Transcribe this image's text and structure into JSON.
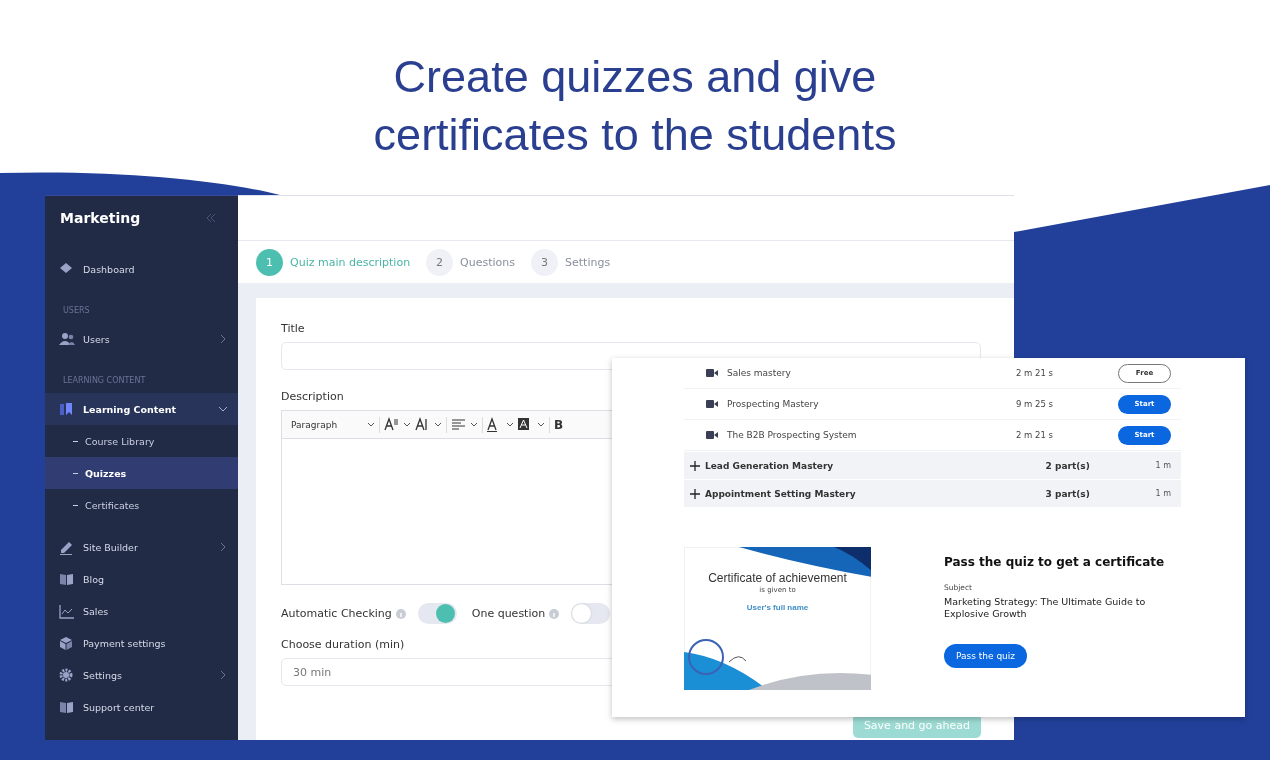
{
  "heading": "Create quizzes and give\ncertificates to the students",
  "sidebar": {
    "title": "Marketing",
    "items": [
      {
        "kind": "item",
        "label": "Dashboard",
        "selected": false
      },
      {
        "kind": "section",
        "label": "USERS"
      },
      {
        "kind": "item",
        "label": "Users",
        "selected": false,
        "expanded": false
      },
      {
        "kind": "section",
        "label": "LEARNING CONTENT"
      },
      {
        "kind": "item",
        "label": "Learning Content",
        "selected": true,
        "expanded": true
      },
      {
        "kind": "subitem",
        "label": "Course Library",
        "selected": false
      },
      {
        "kind": "subitem",
        "label": "Quizzes",
        "selected": true
      },
      {
        "kind": "subitem",
        "label": "Certificates",
        "selected": false
      },
      {
        "kind": "item",
        "label": "Site Builder",
        "selected": false,
        "expanded": false
      },
      {
        "kind": "item",
        "label": "Blog",
        "selected": false
      },
      {
        "kind": "item",
        "label": "Sales",
        "selected": false
      },
      {
        "kind": "item",
        "label": "Payment settings",
        "selected": false
      },
      {
        "kind": "item",
        "label": "Settings",
        "selected": false,
        "expanded": false
      },
      {
        "kind": "item",
        "label": "Support center",
        "selected": false
      }
    ]
  },
  "steps": [
    {
      "number": "1",
      "label": "Quiz main description",
      "selected": true
    },
    {
      "number": "2",
      "label": "Questions",
      "selected": false
    },
    {
      "number": "3",
      "label": "Settings",
      "selected": false
    }
  ],
  "form": {
    "title_label": "Title",
    "description_label": "Description",
    "block_format": "Paragraph",
    "bold": "B",
    "toggles": [
      {
        "label": "Automatic Checking",
        "on": true
      },
      {
        "label": "One question",
        "on": false
      }
    ],
    "duration_label": "Choose duration (min)",
    "duration": "30 min",
    "save_button": {
      "label": "Save and go ahead",
      "disabled": true
    }
  },
  "preview": {
    "lessons": [
      {
        "title": "Sales mastery",
        "duration": "2 m 21 s",
        "action": {
          "label": "Free",
          "kind": "outline"
        }
      },
      {
        "title": "Prospecting Mastery",
        "duration": "9 m 25 s",
        "action": {
          "label": "Start",
          "kind": "filled"
        }
      },
      {
        "title": "The B2B Prospecting System",
        "duration": "2 m 21 s",
        "action": {
          "label": "Start",
          "kind": "filled"
        }
      }
    ],
    "modules": [
      {
        "title": "Lead Generation Mastery",
        "parts": "2 part(s)",
        "duration": "1 m"
      },
      {
        "title": "Appointment Setting Mastery",
        "parts": "3 part(s)",
        "duration": "1 m"
      }
    ],
    "certificate": {
      "title": "Certificate of achievement",
      "subtitle": "is given to",
      "name": "User's full name"
    },
    "promo": {
      "heading": "Pass the quiz to get a certificate",
      "subject_label": "Subject",
      "subject": "Marketing Strategy: The Ultimate Guide to Explosive Growth",
      "button": "Pass the quiz"
    }
  }
}
